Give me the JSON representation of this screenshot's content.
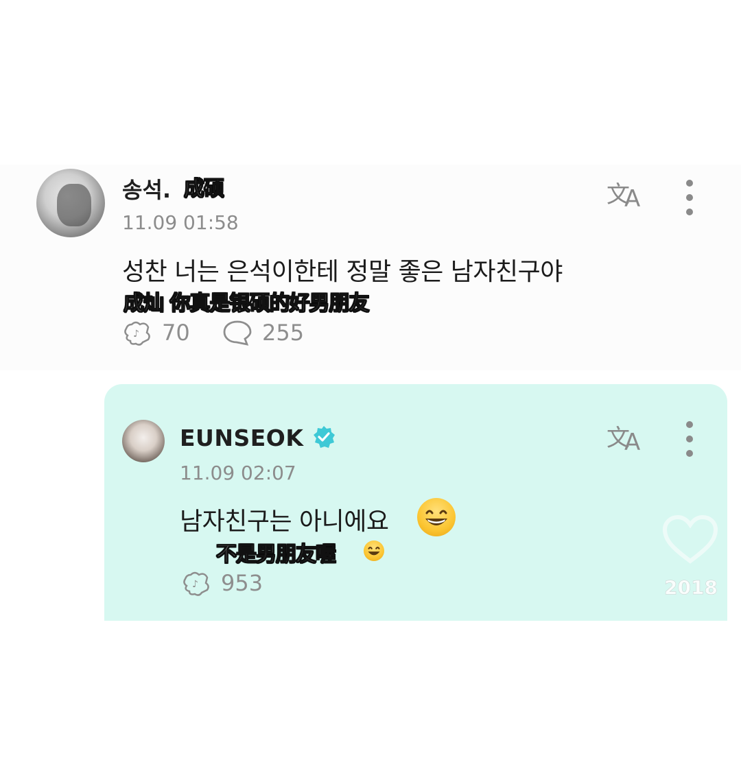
{
  "comment": {
    "author": "송석.",
    "author_sub": "成硕",
    "time": "11.09 01:58",
    "text": "성찬 너는 은석이한테 정말 좋은 남자친구야",
    "subtitle": "成灿 你真是银硕的好男朋友",
    "likes": "70",
    "replies": "255"
  },
  "reply": {
    "author": "EUNSEOK",
    "time": "11.09 02:07",
    "text": "남자친구는 아니에요",
    "subtitle": "不是男朋友喔",
    "likes": "953",
    "heart_count": "2018"
  },
  "icons": {
    "translate": "translate-icon",
    "more": "more-vertical-icon",
    "like": "like-sticker-icon",
    "reply": "speech-bubble-icon",
    "verified": "verified-badge-icon",
    "heart": "heart-icon",
    "emoji": "grinning-face-emoji"
  },
  "colors": {
    "reply_bg": "#d7f8f1",
    "verified": "#3ec9d6",
    "muted": "#8c8c8c"
  }
}
